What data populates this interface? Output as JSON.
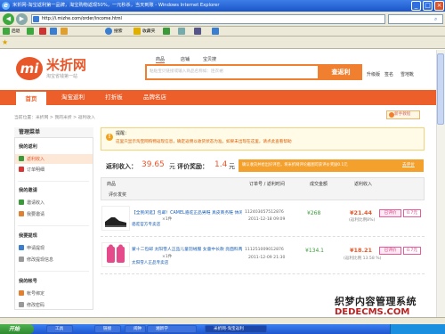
{
  "window": {
    "title": "米折网-淘宝返利第一品牌，淘宝购物返现50%，一元秒杀，当天到账 - Windows Internet Explorer",
    "min": "_",
    "max": "□",
    "close": "×"
  },
  "address": {
    "url": "http://i.mizhe.com/order/income.html",
    "go": "转到",
    "back_icon": "arrow-left",
    "forward_icon": "arrow-right"
  },
  "toolbar": {
    "back": "后退",
    "search": "搜索",
    "favorites": "收藏夹"
  },
  "favbar": {
    "url": "http://i.mizhe.com/order/income.html"
  },
  "site": {
    "logo": "mi",
    "name": "米折网",
    "slogan": "淘宝省钱第一站",
    "search_tabs": [
      "商品",
      "店铺",
      "宝贝搜"
    ],
    "search_placeholder": "粘贴宝贝链接或输入商品名称如：连衣裙",
    "search_button": "查返利",
    "top_links": [
      "升级版",
      "签名",
      "雪地靴"
    ]
  },
  "nav": {
    "items": [
      "首页",
      "淘宝返利",
      "打折板",
      "品牌名店"
    ]
  },
  "breadcrumb": "当前位置：米折网 > 我的米折 > 返利收入",
  "newbie": "新手教程",
  "sidebar": {
    "title": "管理菜单",
    "sections": [
      {
        "heading": "我的返利",
        "items": [
          "返利收入",
          "订单明细"
        ]
      },
      {
        "heading": "我的邀请",
        "items": [
          "邀请收入",
          "我要邀请"
        ]
      },
      {
        "heading": "我要提现",
        "items": [
          "申请提现",
          "修改提现信息"
        ]
      },
      {
        "heading": "我的帐号",
        "items": [
          "帐号绑定",
          "修改密码"
        ]
      }
    ]
  },
  "notice": {
    "title": "提醒：",
    "text": "这里只显示淘宝网购物返现信息，确定返佣以收货状态为准。如果未出现在这里，请点此查看帮助"
  },
  "summary": {
    "rebate_label": "返利收入：",
    "rebate_amount": "39.65",
    "rebate_unit": "元",
    "comment_label": "评价奖励：",
    "comment_amount": "1.4",
    "comment_unit": "元",
    "promo": "确认收货并给出好评后，将米折网评论截图可获评价奖励0.1元",
    "promo_link": "去评价"
  },
  "table": {
    "headers": [
      "商品",
      "订单号 / 返利时间",
      "成交金额",
      "返利收入",
      "评价发奖"
    ],
    "rows": [
      {
        "title": "【全民闲逛】包邮！CAMEL骆驼正品男鞋 真皮商务鞋 休闲鞋",
        "store": "骆驼官方专卖店",
        "qty": "×1件",
        "order": "112403057512876",
        "time": "2011-12-18 09:09",
        "price": "¥268",
        "rebate": "¥21.44",
        "rate": "(返利比例8%)",
        "status": "已评价",
        "bonus": "0.7元"
      },
      {
        "title": "蒙十二包邮 太阳雪人正品儿童羽绒服 女童中长款 亮面料两件套",
        "store": "太阳雪人正品专卖店",
        "qty": "×1件",
        "order": "111251009012876",
        "time": "2011-12-09 21:30",
        "price": "¥134.1",
        "rebate": "¥18.21",
        "rate": "(返利比例 13.58 %)",
        "status": "已评价",
        "bonus": "0.7元"
      }
    ]
  },
  "taskbar": {
    "start": "开始",
    "tasks": [
      "工具",
      "链接",
      "闹钟",
      "湘新学",
      "米折网-淘宝返利"
    ]
  },
  "watermark": {
    "line1": "织梦内容管理系统",
    "line2": "DEDECMS.COM"
  },
  "colors": {
    "brand": "#e8572a",
    "nav": "#ec5f2b",
    "link": "#1a5fb4",
    "pink": "#e0408a"
  }
}
